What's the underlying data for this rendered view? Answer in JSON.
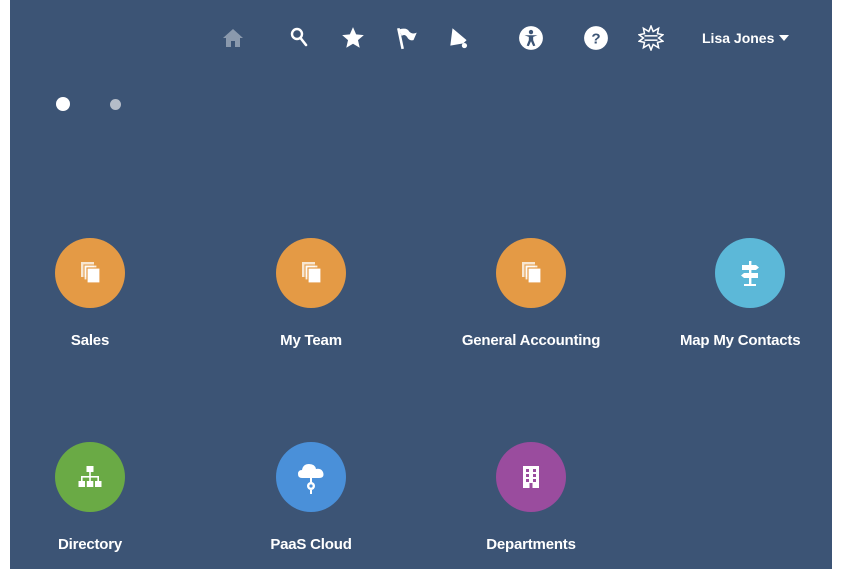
{
  "header": {
    "icons": [
      "home-icon",
      "search-icon",
      "favorites-star-icon",
      "watchlist-flag-icon",
      "notifications-bell-icon",
      "accessibility-icon",
      "help-icon",
      "settings-burst-icon"
    ],
    "user_name": "Lisa Jones"
  },
  "pager": {
    "pages": 2,
    "current": 1
  },
  "tiles": [
    {
      "label": "Sales",
      "color": "#e49a45",
      "icon": "stacked-pages-icon"
    },
    {
      "label": "My Team",
      "color": "#e49a45",
      "icon": "stacked-pages-icon"
    },
    {
      "label": "General Accounting",
      "color": "#e49a45",
      "icon": "stacked-pages-icon"
    },
    {
      "label": "Map My Contacts",
      "color": "#5cb8d8",
      "icon": "signpost-icon"
    },
    {
      "label": "Directory",
      "color": "#6aaa45",
      "icon": "org-chart-icon"
    },
    {
      "label": "PaaS Cloud",
      "color": "#4a90d9",
      "icon": "cloud-plug-icon"
    },
    {
      "label": "Departments",
      "color": "#9a4c9e",
      "icon": "building-icon"
    }
  ]
}
